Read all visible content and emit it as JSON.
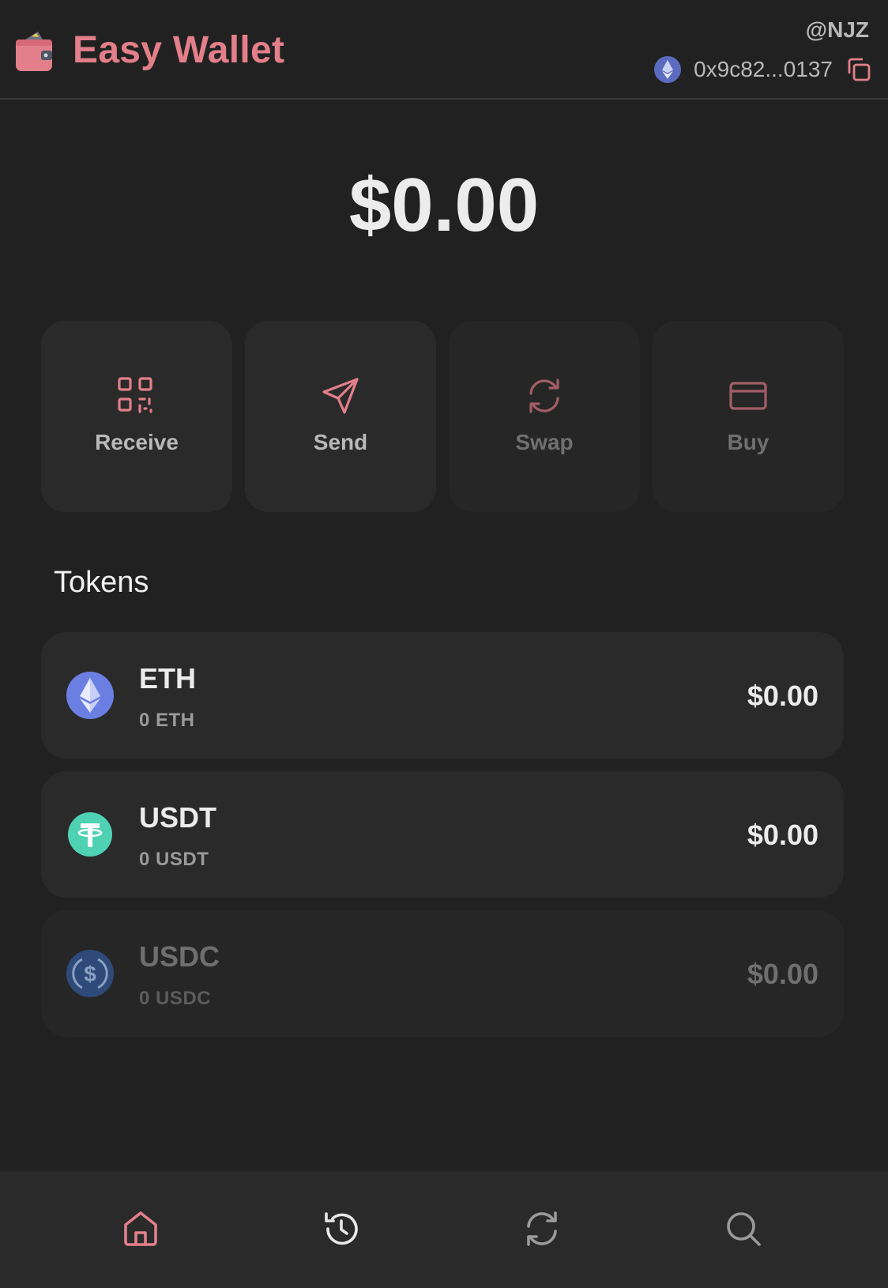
{
  "header": {
    "title": "Easy Wallet",
    "username": "@NJZ",
    "address": "0x9c82...0137",
    "network_icon": "ethereum-icon",
    "accent_color": "#e37f8a"
  },
  "balance": {
    "total": "$0.00"
  },
  "actions": [
    {
      "label": "Receive",
      "icon": "qr-code-icon",
      "enabled": true
    },
    {
      "label": "Send",
      "icon": "send-icon",
      "enabled": true
    },
    {
      "label": "Swap",
      "icon": "swap-icon",
      "enabled": false
    },
    {
      "label": "Buy",
      "icon": "credit-card-icon",
      "enabled": false
    }
  ],
  "tokens_section": {
    "title": "Tokens",
    "items": [
      {
        "name": "ETH",
        "amount": "0 ETH",
        "value": "$0.00",
        "icon": "ethereum-icon",
        "color": "#6b7fe3",
        "enabled": true
      },
      {
        "name": "USDT",
        "amount": "0 USDT",
        "value": "$0.00",
        "icon": "tether-icon",
        "color": "#4fd1b4",
        "enabled": true
      },
      {
        "name": "USDC",
        "amount": "0 USDC",
        "value": "$0.00",
        "icon": "usdc-icon",
        "color": "#3a5f9a",
        "enabled": false
      }
    ]
  },
  "bottom_nav": [
    {
      "name": "home",
      "icon": "home-icon",
      "active": true
    },
    {
      "name": "history",
      "icon": "history-icon",
      "active": false
    },
    {
      "name": "swap",
      "icon": "swap-icon",
      "active": false
    },
    {
      "name": "search",
      "icon": "search-icon",
      "active": false
    }
  ]
}
